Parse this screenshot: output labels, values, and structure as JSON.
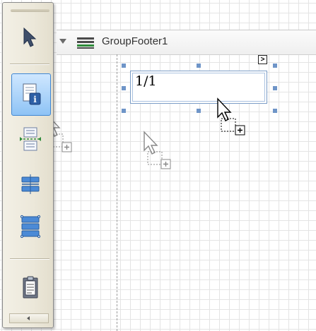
{
  "band": {
    "title": "GroupFooter1"
  },
  "label_control": {
    "text": "1/1"
  },
  "smart_tag": {
    "glyph": ">"
  },
  "toolbox": {
    "tools": [
      {
        "name": "pointer",
        "icon": "pointer-icon"
      },
      {
        "name": "page-info",
        "icon": "page-info-icon",
        "selected": true
      },
      {
        "name": "page-break",
        "icon": "page-break-icon"
      },
      {
        "name": "line",
        "icon": "line-icon"
      },
      {
        "name": "table",
        "icon": "table-icon"
      },
      {
        "name": "subreport",
        "icon": "subreport-icon"
      }
    ]
  },
  "colors": {
    "selection": "#6f95c8",
    "accent": "#3f86d3",
    "toolbox_bg": "#ece8da"
  }
}
